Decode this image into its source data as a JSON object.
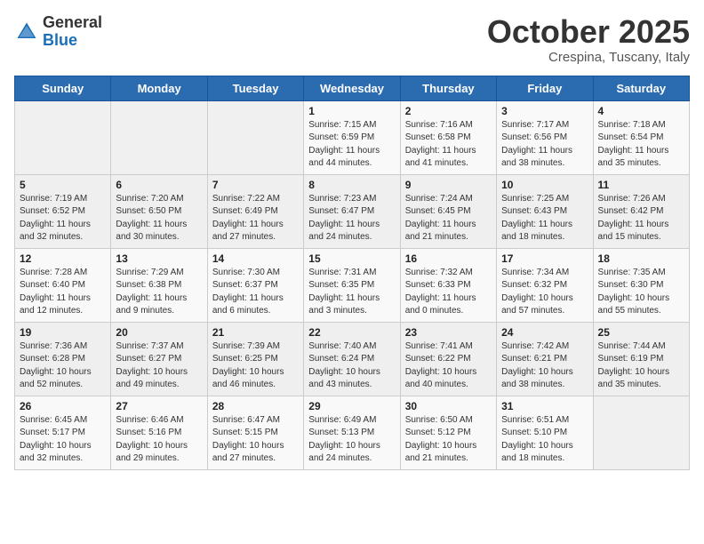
{
  "logo": {
    "general": "General",
    "blue": "Blue"
  },
  "title": "October 2025",
  "subtitle": "Crespina, Tuscany, Italy",
  "days_of_week": [
    "Sunday",
    "Monday",
    "Tuesday",
    "Wednesday",
    "Thursday",
    "Friday",
    "Saturday"
  ],
  "weeks": [
    [
      {
        "day": "",
        "sunrise": "",
        "sunset": "",
        "daylight": ""
      },
      {
        "day": "",
        "sunrise": "",
        "sunset": "",
        "daylight": ""
      },
      {
        "day": "",
        "sunrise": "",
        "sunset": "",
        "daylight": ""
      },
      {
        "day": "1",
        "sunrise": "Sunrise: 7:15 AM",
        "sunset": "Sunset: 6:59 PM",
        "daylight": "Daylight: 11 hours and 44 minutes."
      },
      {
        "day": "2",
        "sunrise": "Sunrise: 7:16 AM",
        "sunset": "Sunset: 6:58 PM",
        "daylight": "Daylight: 11 hours and 41 minutes."
      },
      {
        "day": "3",
        "sunrise": "Sunrise: 7:17 AM",
        "sunset": "Sunset: 6:56 PM",
        "daylight": "Daylight: 11 hours and 38 minutes."
      },
      {
        "day": "4",
        "sunrise": "Sunrise: 7:18 AM",
        "sunset": "Sunset: 6:54 PM",
        "daylight": "Daylight: 11 hours and 35 minutes."
      }
    ],
    [
      {
        "day": "5",
        "sunrise": "Sunrise: 7:19 AM",
        "sunset": "Sunset: 6:52 PM",
        "daylight": "Daylight: 11 hours and 32 minutes."
      },
      {
        "day": "6",
        "sunrise": "Sunrise: 7:20 AM",
        "sunset": "Sunset: 6:50 PM",
        "daylight": "Daylight: 11 hours and 30 minutes."
      },
      {
        "day": "7",
        "sunrise": "Sunrise: 7:22 AM",
        "sunset": "Sunset: 6:49 PM",
        "daylight": "Daylight: 11 hours and 27 minutes."
      },
      {
        "day": "8",
        "sunrise": "Sunrise: 7:23 AM",
        "sunset": "Sunset: 6:47 PM",
        "daylight": "Daylight: 11 hours and 24 minutes."
      },
      {
        "day": "9",
        "sunrise": "Sunrise: 7:24 AM",
        "sunset": "Sunset: 6:45 PM",
        "daylight": "Daylight: 11 hours and 21 minutes."
      },
      {
        "day": "10",
        "sunrise": "Sunrise: 7:25 AM",
        "sunset": "Sunset: 6:43 PM",
        "daylight": "Daylight: 11 hours and 18 minutes."
      },
      {
        "day": "11",
        "sunrise": "Sunrise: 7:26 AM",
        "sunset": "Sunset: 6:42 PM",
        "daylight": "Daylight: 11 hours and 15 minutes."
      }
    ],
    [
      {
        "day": "12",
        "sunrise": "Sunrise: 7:28 AM",
        "sunset": "Sunset: 6:40 PM",
        "daylight": "Daylight: 11 hours and 12 minutes."
      },
      {
        "day": "13",
        "sunrise": "Sunrise: 7:29 AM",
        "sunset": "Sunset: 6:38 PM",
        "daylight": "Daylight: 11 hours and 9 minutes."
      },
      {
        "day": "14",
        "sunrise": "Sunrise: 7:30 AM",
        "sunset": "Sunset: 6:37 PM",
        "daylight": "Daylight: 11 hours and 6 minutes."
      },
      {
        "day": "15",
        "sunrise": "Sunrise: 7:31 AM",
        "sunset": "Sunset: 6:35 PM",
        "daylight": "Daylight: 11 hours and 3 minutes."
      },
      {
        "day": "16",
        "sunrise": "Sunrise: 7:32 AM",
        "sunset": "Sunset: 6:33 PM",
        "daylight": "Daylight: 11 hours and 0 minutes."
      },
      {
        "day": "17",
        "sunrise": "Sunrise: 7:34 AM",
        "sunset": "Sunset: 6:32 PM",
        "daylight": "Daylight: 10 hours and 57 minutes."
      },
      {
        "day": "18",
        "sunrise": "Sunrise: 7:35 AM",
        "sunset": "Sunset: 6:30 PM",
        "daylight": "Daylight: 10 hours and 55 minutes."
      }
    ],
    [
      {
        "day": "19",
        "sunrise": "Sunrise: 7:36 AM",
        "sunset": "Sunset: 6:28 PM",
        "daylight": "Daylight: 10 hours and 52 minutes."
      },
      {
        "day": "20",
        "sunrise": "Sunrise: 7:37 AM",
        "sunset": "Sunset: 6:27 PM",
        "daylight": "Daylight: 10 hours and 49 minutes."
      },
      {
        "day": "21",
        "sunrise": "Sunrise: 7:39 AM",
        "sunset": "Sunset: 6:25 PM",
        "daylight": "Daylight: 10 hours and 46 minutes."
      },
      {
        "day": "22",
        "sunrise": "Sunrise: 7:40 AM",
        "sunset": "Sunset: 6:24 PM",
        "daylight": "Daylight: 10 hours and 43 minutes."
      },
      {
        "day": "23",
        "sunrise": "Sunrise: 7:41 AM",
        "sunset": "Sunset: 6:22 PM",
        "daylight": "Daylight: 10 hours and 40 minutes."
      },
      {
        "day": "24",
        "sunrise": "Sunrise: 7:42 AM",
        "sunset": "Sunset: 6:21 PM",
        "daylight": "Daylight: 10 hours and 38 minutes."
      },
      {
        "day": "25",
        "sunrise": "Sunrise: 7:44 AM",
        "sunset": "Sunset: 6:19 PM",
        "daylight": "Daylight: 10 hours and 35 minutes."
      }
    ],
    [
      {
        "day": "26",
        "sunrise": "Sunrise: 6:45 AM",
        "sunset": "Sunset: 5:17 PM",
        "daylight": "Daylight: 10 hours and 32 minutes."
      },
      {
        "day": "27",
        "sunrise": "Sunrise: 6:46 AM",
        "sunset": "Sunset: 5:16 PM",
        "daylight": "Daylight: 10 hours and 29 minutes."
      },
      {
        "day": "28",
        "sunrise": "Sunrise: 6:47 AM",
        "sunset": "Sunset: 5:15 PM",
        "daylight": "Daylight: 10 hours and 27 minutes."
      },
      {
        "day": "29",
        "sunrise": "Sunrise: 6:49 AM",
        "sunset": "Sunset: 5:13 PM",
        "daylight": "Daylight: 10 hours and 24 minutes."
      },
      {
        "day": "30",
        "sunrise": "Sunrise: 6:50 AM",
        "sunset": "Sunset: 5:12 PM",
        "daylight": "Daylight: 10 hours and 21 minutes."
      },
      {
        "day": "31",
        "sunrise": "Sunrise: 6:51 AM",
        "sunset": "Sunset: 5:10 PM",
        "daylight": "Daylight: 10 hours and 18 minutes."
      },
      {
        "day": "",
        "sunrise": "",
        "sunset": "",
        "daylight": ""
      }
    ]
  ]
}
